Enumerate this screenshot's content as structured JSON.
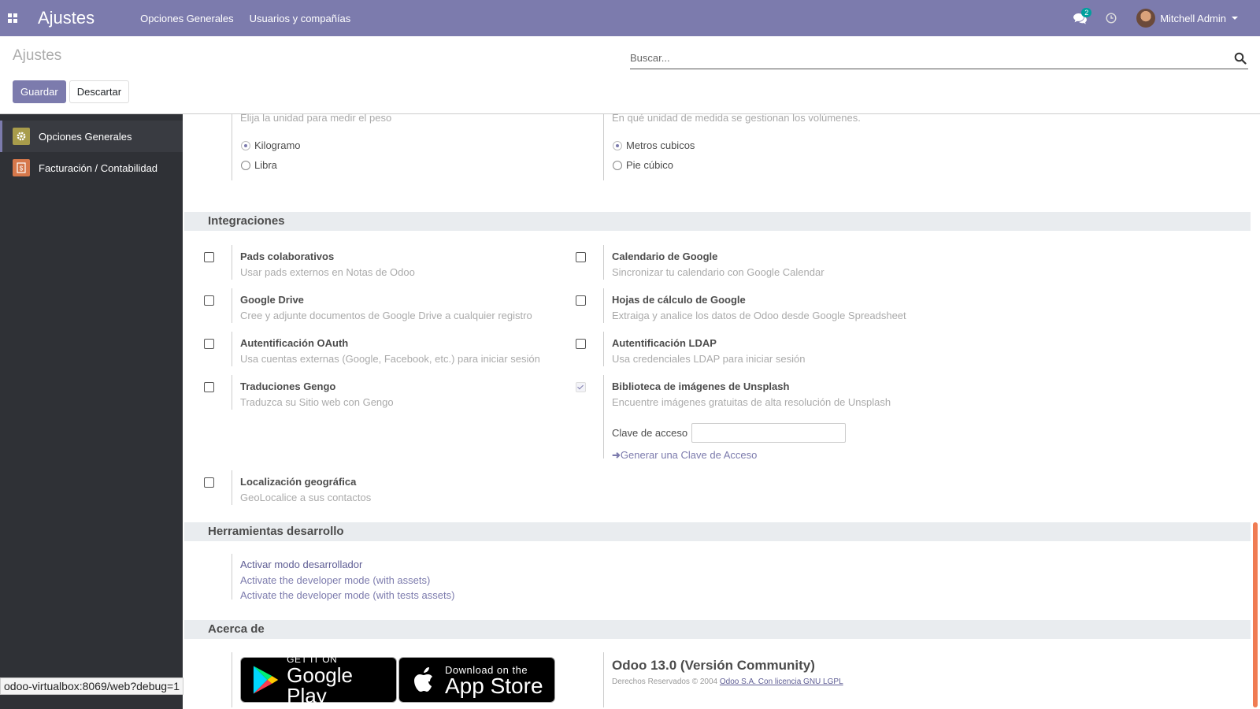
{
  "navbar": {
    "app_title": "Ajustes",
    "menu": [
      "Opciones Generales",
      "Usuarios y compañías"
    ],
    "chat_count": "2",
    "user_name": "Mitchell Admin",
    "bg_color": "#7c7bad"
  },
  "control_panel": {
    "title": "Ajustes",
    "save_label": "Guardar",
    "discard_label": "Descartar",
    "search_placeholder": "Buscar..."
  },
  "sidebar": {
    "items": [
      {
        "label": "Opciones Generales",
        "icon": "gear-icon",
        "color": "#a89c4b"
      },
      {
        "label": "Facturación / Contabilidad",
        "icon": "invoice-icon",
        "color": "#d6784b"
      }
    ]
  },
  "units": {
    "weight_desc": "Elija la unidad para medir el peso",
    "weight_options": [
      "Kilogramo",
      "Libra"
    ],
    "volume_desc": "En qué unidad de medida se gestionan los volúmenes.",
    "volume_options": [
      "Metros cubicos",
      "Pie cúbico"
    ]
  },
  "integrations": {
    "header": "Integraciones",
    "left": [
      {
        "title": "Pads colaborativos",
        "desc": "Usar pads externos en Notas de Odoo"
      },
      {
        "title": "Google Drive",
        "desc": "Cree y adjunte documentos de Google Drive a cualquier registro"
      },
      {
        "title": "Autentificación OAuth",
        "desc": "Usa cuentas externas (Google, Facebook, etc.) para iniciar sesión"
      },
      {
        "title": "Traduciones Gengo",
        "desc": "Traduzca su Sitio web con Gengo"
      },
      {
        "title": "Localización geográfica",
        "desc": "GeoLocalice a sus contactos"
      }
    ],
    "right": [
      {
        "title": "Calendario de Google",
        "desc": "Sincronizar tu calendario con Google Calendar"
      },
      {
        "title": "Hojas de cálculo de Google",
        "desc": "Extraiga y analice los datos de Odoo desde Google Spreadsheet"
      },
      {
        "title": "Autentificación LDAP",
        "desc": "Usa credenciales LDAP para iniciar sesión"
      },
      {
        "title": "Biblioteca de imágenes de Unsplash",
        "desc": "Encuentre imágenes gratuitas de alta resolución de Unsplash"
      }
    ],
    "access_key_label": "Clave de acceso",
    "generate_key_link": "Generar una Clave de Acceso"
  },
  "dev_tools": {
    "header": "Herramientas desarrollo",
    "links": [
      "Activar modo desarrollador",
      "Activate the developer mode (with assets)",
      "Activate the developer mode (with tests assets)"
    ]
  },
  "about": {
    "header": "Acerca de",
    "google_play_small": "GET IT ON",
    "google_play_big": "Google Play",
    "app_store_small": "Download on the",
    "app_store_big": "App Store",
    "version": "Odoo 13.0 (Versión Community)",
    "copyright": "Derechos Reservados © 2004",
    "license_link": "Odoo S.A. Con licencia GNU LGPL"
  },
  "status_url": "odoo-virtualbox:8069/web?debug=1"
}
